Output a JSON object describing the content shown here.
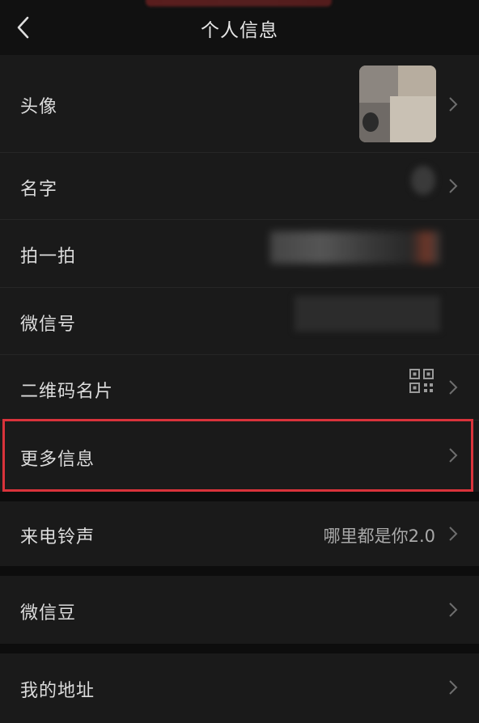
{
  "header": {
    "title": "个人信息"
  },
  "rows": [
    {
      "label": "头像",
      "value": ""
    },
    {
      "label": "名字",
      "value": ""
    },
    {
      "label": "拍一拍",
      "value": ""
    },
    {
      "label": "微信号",
      "value": ""
    },
    {
      "label": "二维码名片",
      "value": ""
    },
    {
      "label": "更多信息",
      "value": ""
    },
    {
      "label": "来电铃声",
      "value": "哪里都是你2.0"
    },
    {
      "label": "微信豆",
      "value": ""
    },
    {
      "label": "我的地址",
      "value": ""
    }
  ],
  "icons": {
    "back": "back-arrow-icon",
    "chevron": "chevron-right-icon",
    "qrcode": "qr-code-icon"
  },
  "colors": {
    "background": "#111111",
    "row": "#1a1a1a",
    "highlight": "#d9333b"
  }
}
